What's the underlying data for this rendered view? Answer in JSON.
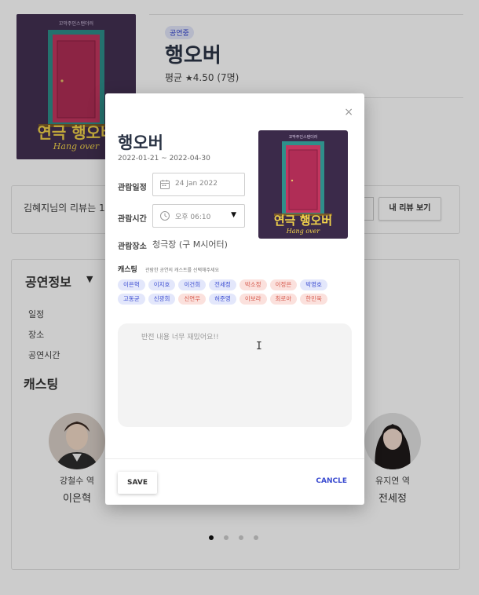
{
  "background": {
    "genre_badge": "공연중",
    "title": "행오버",
    "rating_prefix": "평균",
    "rating_star": "★",
    "rating_value": "4.50 (7명)",
    "review_text": "김혜지님의 리뷰는 1개",
    "my_review_button": "내 리뷰 보기",
    "info_title": "공연정보",
    "info_caret": "▼",
    "info_labels": [
      "일정",
      "장소",
      "공연시간"
    ],
    "cast_heading": "캐스팅",
    "cast": [
      {
        "role": "강철수 역",
        "name": "이은혁"
      },
      {
        "role": "유지연 역",
        "name": "전세정"
      }
    ],
    "poster": {
      "main_text": "연극 행오버",
      "sub_text": "Hang over",
      "top_text": "꼬막주인스탠더러"
    }
  },
  "modal": {
    "close_symbol": "×",
    "title": "행오버",
    "dates": "2022-01-21 ~ 2022-04-30",
    "date_label": "관람일정",
    "date_value": "24 Jan 2022",
    "time_label": "관람시간",
    "time_value": "오후 06:10",
    "time_caret": "▼",
    "venue_label": "관람장소",
    "venue_value": "청극장 (구 M시어터)",
    "cast_label": "캐스팅",
    "cast_hint": "관람한 공연의 캐스트를 선택해주세요",
    "chips": [
      {
        "label": "이은혁",
        "color": "blue"
      },
      {
        "label": "이지호",
        "color": "blue"
      },
      {
        "label": "이건희",
        "color": "blue"
      },
      {
        "label": "전세정",
        "color": "blue"
      },
      {
        "label": "박소정",
        "color": "pink"
      },
      {
        "label": "이정은",
        "color": "pink"
      },
      {
        "label": "박영호",
        "color": "blue"
      },
      {
        "label": "고동균",
        "color": "blue"
      },
      {
        "label": "신광희",
        "color": "blue"
      },
      {
        "label": "신연우",
        "color": "pink"
      },
      {
        "label": "허준영",
        "color": "blue"
      },
      {
        "label": "이보라",
        "color": "pink"
      },
      {
        "label": "최로아",
        "color": "pink"
      },
      {
        "label": "한민욱",
        "color": "pink"
      }
    ],
    "review_placeholder": "반전 내용 너무 재밌어요!!",
    "cursor_glyph": "I",
    "save_label": "SAVE",
    "cancel_label": "CANCLE"
  },
  "carousel": {
    "count": 4,
    "active": 0
  },
  "colors": {
    "accent": "#3a4bd0",
    "chip_blue_bg": "#e3e7fb",
    "chip_pink_bg": "#fbe1dd",
    "chip_pink_text": "#d5574a",
    "title_dark": "#2b3445"
  }
}
